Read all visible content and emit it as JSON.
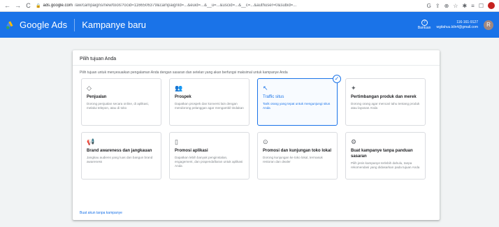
{
  "browser": {
    "back_icon": "arrow-left-icon",
    "url_domain": "ads.google.com",
    "url_path": "/aw/campaigns/new/tools?ocid=1166506379&campaignId=...&euid=...&__u=...&uscid=...&__c=...&authuser=0&subid=...",
    "profile_initial": ""
  },
  "header": {
    "product": "Google Ads",
    "title": "Kampanye baru",
    "help_label": "Bantuan",
    "account_id": "116-161-9127",
    "account_email": "wgitahuu.kiln4@gmail.com",
    "avatar_initial": "R"
  },
  "panel": {
    "title": "Pilih tujuan Anda",
    "description": "Pilih tujuan untuk menyesuaikan pengalaman Anda dengan sasaran dan setelan yang akan berfungsi maksimal untuk kampanye Anda",
    "footer_link": "Buat akun tanpa kampanye"
  },
  "goals": [
    {
      "icon": "tag-icon",
      "glyph": "◇",
      "title": "Penjualan",
      "desc": "Dorong penjualan secara online, di aplikasi, melalui telepon, atau di toko"
    },
    {
      "icon": "people-icon",
      "glyph": "👥",
      "title": "Prospek",
      "desc": "Dapatkan prospek dan konversi lain dengan mendorong pelanggan agar mengambil tindakan"
    },
    {
      "icon": "cursor-click-icon",
      "glyph": "↖",
      "title": "Traffic situs",
      "desc": "Tarik orang yang tepat untuk mengunjungi situs Anda",
      "selected": true
    },
    {
      "icon": "sparkle-icon",
      "glyph": "✦",
      "title": "Pertimbangan produk dan merek",
      "desc": "Dorong orang agar mencari tahu tentang produk atau layanan Anda"
    },
    {
      "icon": "megaphone-icon",
      "glyph": "📢",
      "title": "Brand awareness dan jangkauan",
      "desc": "Jangkau audiens yang luas dan bangun brand awareness"
    },
    {
      "icon": "phone-app-icon",
      "glyph": "▯",
      "title": "Promosi aplikasi",
      "desc": "Dapatkan lebih banyak penginstalan, engagement, dan prapendaftaran untuk aplikasi Anda"
    },
    {
      "icon": "location-pin-icon",
      "glyph": "⊙",
      "title": "Promosi dan kunjungan toko lokal",
      "desc": "Dorong kunjungan ke toko lokal, termasuk restoran dan dealer"
    },
    {
      "icon": "gear-icon",
      "glyph": "⚙",
      "title": "Buat kampanye tanpa panduan sasaran",
      "desc": "Pilih jenis kampanye terlebih dahulu, tanpa rekomendasi yang didasarkan pada tujuan Anda"
    }
  ]
}
